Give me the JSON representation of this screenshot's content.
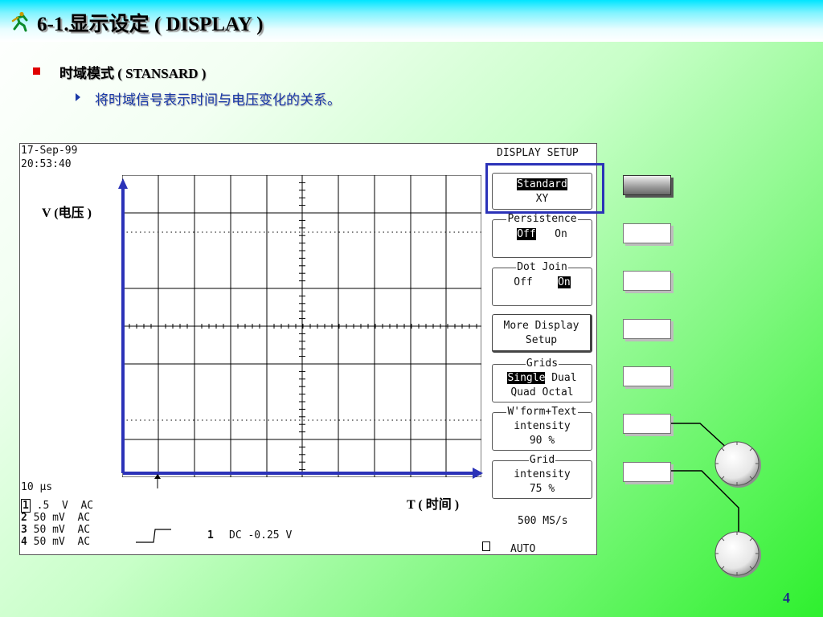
{
  "header": {
    "title": "6-1.显示设定 ( DISPLAY )"
  },
  "bullet": {
    "text": "时域模式 ( STANSARD )"
  },
  "subbullet": {
    "text": "将时域信号表示时间与电压变化的关系。"
  },
  "scope": {
    "date": "17-Sep-99",
    "time": "20:53:40",
    "menu_title": "DISPLAY SETUP",
    "timebase": "10 μs",
    "channels": [
      {
        "num": "1",
        "text": " .5  V  AC"
      },
      {
        "num": "2",
        "text": " 50 mV  AC"
      },
      {
        "num": "3",
        "text": " 50 mV  AC"
      },
      {
        "num": "4",
        "text": " 50 mV  AC"
      }
    ],
    "trigger_num": "1",
    "trigger_text": "DC -0.25 V",
    "sample_rate": "500 MS/s",
    "trigger_mode": "AUTO",
    "softkeys": {
      "mode": {
        "opt1": "Standard",
        "opt2": "XY"
      },
      "persistence": {
        "legend": "Persistence",
        "off": "Off",
        "on": "On"
      },
      "dotjoin": {
        "legend": "Dot Join",
        "off": "Off",
        "on": "On"
      },
      "more": {
        "line1": "More Display",
        "line2": "Setup"
      },
      "grids": {
        "legend": "Grids",
        "single": "Single",
        "dual": "Dual",
        "quad": "Quad",
        "octal": "Octal"
      },
      "wform": {
        "legend": "W'form+Text",
        "line1": "intensity",
        "line2": "90 %"
      },
      "grid_int": {
        "legend": "Grid",
        "line1": "intensity",
        "line2": "75 %"
      }
    }
  },
  "annotations": {
    "v_label": "V (电压 )",
    "t_label": "T ( 时间 )"
  },
  "colors": {
    "accent_blue": "#2b32b8",
    "bullet_red": "#e00000",
    "sub_text": "#1a3aa8"
  },
  "footer": {
    "page": "4"
  }
}
